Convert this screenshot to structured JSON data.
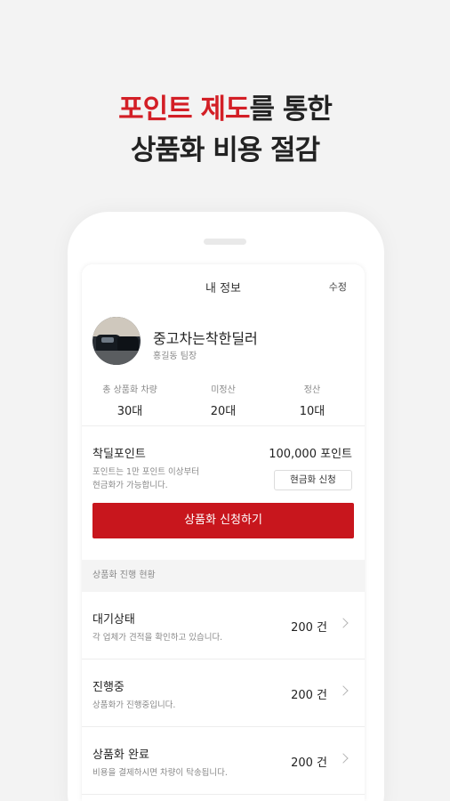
{
  "headline": {
    "line1_accent": "포인트 제도",
    "line1_rest": "를 통한",
    "line2": "상품화 비용 절감"
  },
  "appbar": {
    "title": "내 정보",
    "edit_label": "수정"
  },
  "profile": {
    "name": "중고차는착한딜러",
    "role": "홍길동 팀장"
  },
  "stats": [
    {
      "label": "총 상품화 차량",
      "value": "30대"
    },
    {
      "label": "미정산",
      "value": "20대"
    },
    {
      "label": "정산",
      "value": "10대"
    }
  ],
  "points": {
    "title": "착딜포인트",
    "value": "100,000 포인트",
    "desc_line1": "포인트는 1만 포인트 이상부터",
    "desc_line2": "현금화가 가능합니다.",
    "cash_button": "현금화 신청"
  },
  "apply_button": "상품화 신청하기",
  "progress_section": {
    "title": "상품화 진행 현황",
    "items": [
      {
        "title": "대기상태",
        "desc": "각 업체가 견적을 확인하고 있습니다.",
        "count": "200 건"
      },
      {
        "title": "진행중",
        "desc": "상품화가 진행중입니다.",
        "count": "200 건"
      },
      {
        "title": "상품화 완료",
        "desc": "비용을 결제하시면 차량이 탁송됩니다.",
        "count": "200 건"
      }
    ]
  },
  "colors": {
    "accent": "#c8161d",
    "headline_accent": "#d31f26",
    "background": "#f3f3f3"
  }
}
